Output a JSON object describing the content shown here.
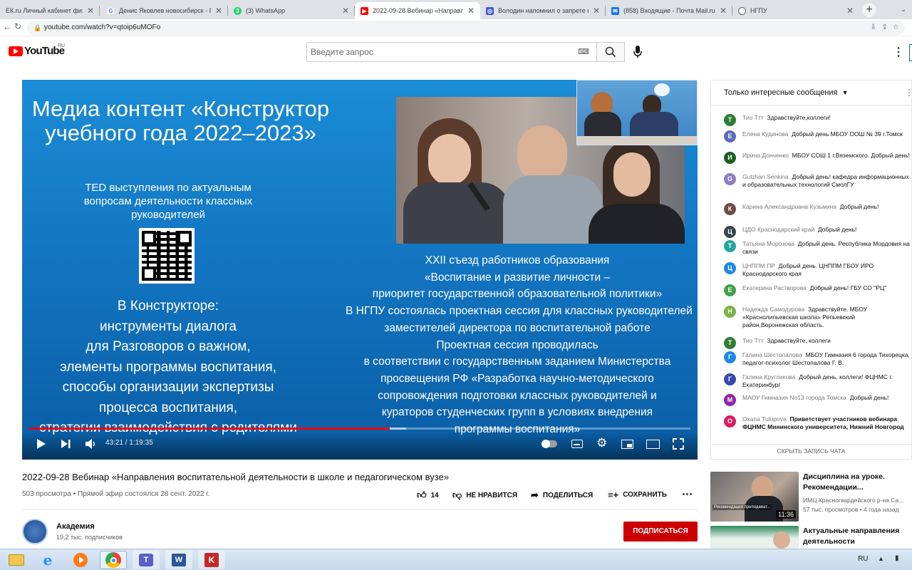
{
  "browser": {
    "tabs": [
      {
        "title": "ЕК.ru Личный кабинет физиче",
        "fav_color": "#e8eaed",
        "fav_text": ""
      },
      {
        "title": "Денис Яковлев новосибирск - П",
        "fav_color": "#ffffff",
        "fav_text": "G"
      },
      {
        "title": "(3) WhatsApp",
        "fav_color": "#25d366",
        "fav_text": "3"
      },
      {
        "title": "2022-09-28 Вебинар «Направле",
        "fav_color": "#ff0000",
        "fav_text": "▶"
      },
      {
        "title": "Володин напомнил о запрете н",
        "fav_color": "#3b5bdb",
        "fav_text": "◎"
      },
      {
        "title": "(858) Входящие - Почта Mail.ru",
        "fav_color": "#1a73e8",
        "fav_text": "✉"
      },
      {
        "title": "НГПУ",
        "fav_color": "#ffffff",
        "fav_text": "◯"
      }
    ],
    "new_tab": "+",
    "url": "youtube.com/watch?v=qtoip6uMOFo"
  },
  "yt": {
    "logo": "YouTube",
    "logo_region": "RU",
    "search_placeholder": "Введите запрос"
  },
  "slide": {
    "left_title": "Медиа контент «Конструктор учебного года 2022–2023»",
    "left_sub": "TED выступления по актуальным вопросам деятельности классных руководителей",
    "left_list": [
      "В Конструкторе:",
      "инструменты диалога",
      "для Разговоров о важном,",
      "элементы программы воспитания,",
      "способы организации экспертизы",
      "процесса воспитания,",
      "стратегии взаимодействия с родителями"
    ],
    "right_lines": [
      "XXII съезд работников образования",
      "«Воспитание и развитие личности –",
      "приоритет государственной образовательной политики»",
      "В НГПУ состоялась проектная сессия для классных руководителей",
      "заместителей директора по воспитательной работе",
      "Проектная сессия проводилась",
      "в соответствии с государственным заданием Министерства",
      "просвещения РФ «Разработка научно-методического",
      "сопровождения подготовки классных руководителей и",
      "кураторов студенческих групп в условиях внедрения",
      "программы воспитания»"
    ]
  },
  "player": {
    "time": "43:21 / 1:19:35",
    "progress": 0.545
  },
  "video": {
    "title": "2022-09-28 Вебинар «Направления воспитательной деятельности в школе и педагогическом вузе»",
    "meta": "503 просмотра • Прямой эфир состоялся 28 сент. 2022 г.",
    "likes": "14",
    "dislike": "НЕ НРАВИТСЯ",
    "share": "ПОДЕЛИТЬСЯ",
    "save": "СОХРАНИТЬ",
    "channel": "Академия",
    "subs": "19,2 тыс. подписчиков",
    "subscribe": "ПОДПИСАТЬСЯ"
  },
  "chat": {
    "mode": "Только интересные сообщения",
    "hide": "СКРЫТЬ ЗАПИСЬ ЧАТА",
    "messages": [
      {
        "initial": "Т",
        "color": "#2e7d32",
        "author": "Тио Ттт",
        "text": "Здравствуйте,коллеги!"
      },
      {
        "initial": "Е",
        "color": "#5c6bc0",
        "author": "Елена Кудинова",
        "text": "Добрый день МБОУ ООШ № 39 г.Томск"
      },
      {
        "initial": "И",
        "color": "#1b5e20",
        "author": "Ирина Донченко",
        "text": "МБОУ СОШ 1 г.Вяземского. Добрый день!"
      },
      {
        "initial": "G",
        "color": "#8e7cc3",
        "author": "Gulzhan Senkina",
        "text": "Добрый день! кафедра информационных и образовательных технологий СмолГУ"
      },
      {
        "initial": "К",
        "color": "#6d4c41",
        "author": "Карина Александровна Кузьмина",
        "text": "Добрый день!"
      },
      {
        "initial": "Ц",
        "color": "#37474f",
        "author": "ЦДО Краснодарский край",
        "text": "Добрый день!"
      },
      {
        "initial": "Т",
        "color": "#26a69a",
        "author": "Татьяна Морозова",
        "text": "Добрый день. Республика Мордовия на связи"
      },
      {
        "initial": "Ц",
        "color": "#1e88e5",
        "author": "ЦНППМ ПР",
        "text": "Добрый день. ЦНППМ ГБОУ ИРО Краснодарского края"
      },
      {
        "initial": "Е",
        "color": "#43a047",
        "author": "Екатерина Растворова",
        "text": "Добрый день! ГБУ СО \"РЦ\""
      },
      {
        "initial": "Н",
        "color": "#7cb342",
        "author": "Надежда Самодурова",
        "text": "Здравствуйте. МБОУ «Краснолипьевская школа» Репьевский район,Воронежская область."
      },
      {
        "initial": "Т",
        "color": "#2e7d32",
        "author": "Тио Ттт",
        "text": "Здравствуйте, коллеги"
      },
      {
        "initial": "Г",
        "color": "#1e88e5",
        "author": "Галина Шестопалова",
        "text": "МБОУ Гимназия 6 города Тихорецка, педагог-психолог Шестопалова Г. В."
      },
      {
        "initial": "Г",
        "color": "#3949ab",
        "author": "Галина Кругликова",
        "text": "Добрый день, коллеги! ФЦНМС г. Екатеринбург"
      },
      {
        "initial": "М",
        "color": "#8e24aa",
        "author": "МАОУ Гимназия No13 города Томска",
        "text": "Добрый день!"
      },
      {
        "initial": "О",
        "color": "#d81b60",
        "author": "Охапа Tulupova",
        "text": "Приветствует участников вебинара ФЦНМС Мининского университета, Нижний Новгород"
      }
    ]
  },
  "recommended": [
    {
      "title": "Дисциплина на уроке. Рекомендации...",
      "channel": "ИМЦ Красногвардейского р-на Са...",
      "meta": "57 тыс. просмотров • 4 года назад",
      "duration": "11:36",
      "thumb_caption": "Рекомендации преподават..."
    },
    {
      "title": "Актуальные направления деятельности методической...",
      "channel": "",
      "meta": "",
      "duration": "",
      "thumb_caption": ""
    }
  ],
  "taskbar": {
    "lang": "RU"
  }
}
